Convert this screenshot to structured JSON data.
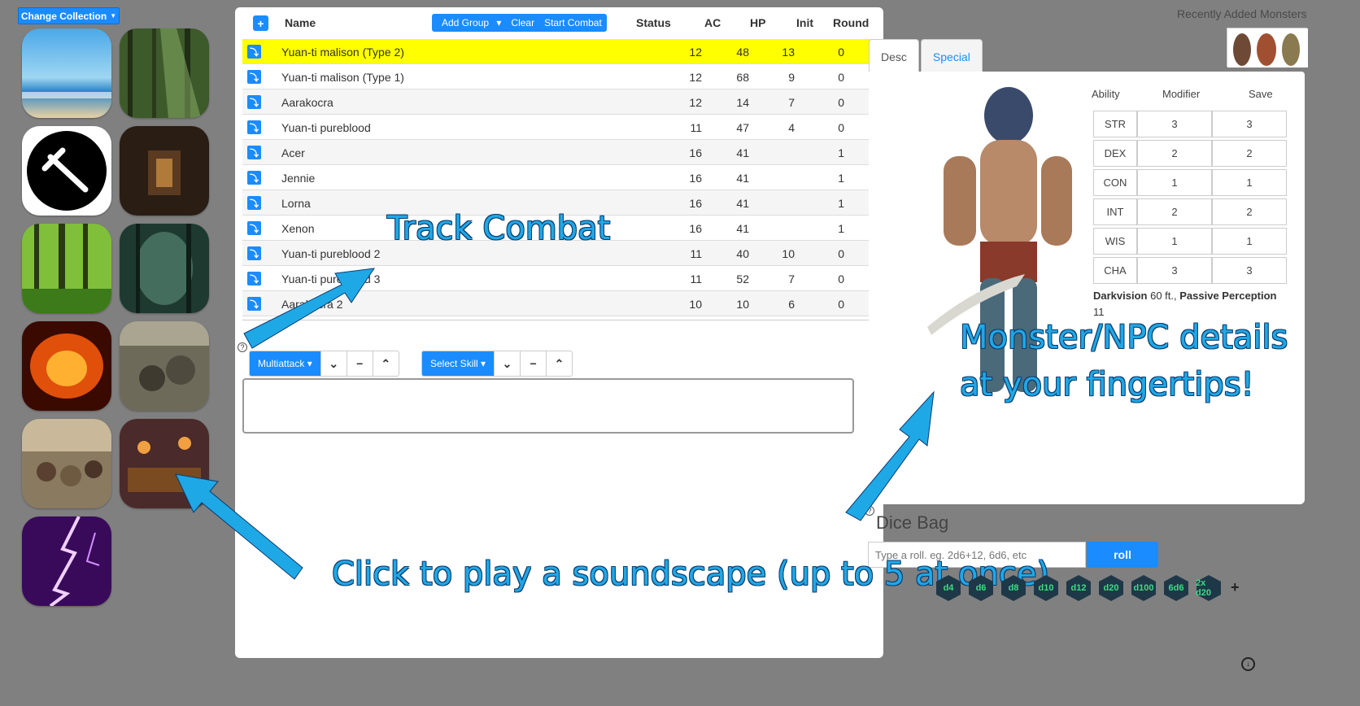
{
  "sidebar": {
    "change_collection_label": "Change Collection",
    "soundscapes": [
      {
        "name": "beach"
      },
      {
        "name": "forest-sunlight"
      },
      {
        "name": "combat-sword"
      },
      {
        "name": "dungeon-corridor"
      },
      {
        "name": "green-forest"
      },
      {
        "name": "dark-forest"
      },
      {
        "name": "fire"
      },
      {
        "name": "battle"
      },
      {
        "name": "market"
      },
      {
        "name": "tavern"
      },
      {
        "name": "lightning-storm"
      }
    ]
  },
  "combat": {
    "columns": {
      "name": "Name",
      "status": "Status",
      "ac": "AC",
      "hp": "HP",
      "init": "Init",
      "round": "Round"
    },
    "add_icon": "+",
    "buttons": {
      "add_group": "Add Group",
      "clear": "Clear",
      "start_combat": "Start Combat"
    },
    "rows": [
      {
        "name": "Yuan-ti malison (Type 2)",
        "ac": "12",
        "hp": "48",
        "init": "13",
        "round": "0",
        "active": true
      },
      {
        "name": "Yuan-ti malison (Type 1)",
        "ac": "12",
        "hp": "68",
        "init": "9",
        "round": "0"
      },
      {
        "name": "Aarakocra",
        "ac": "12",
        "hp": "14",
        "init": "7",
        "round": "0"
      },
      {
        "name": "Yuan-ti pureblood",
        "ac": "11",
        "hp": "47",
        "init": "4",
        "round": "0"
      },
      {
        "name": "Acer",
        "ac": "16",
        "hp": "41",
        "init": "",
        "round": "1"
      },
      {
        "name": "Jennie",
        "ac": "16",
        "hp": "41",
        "init": "",
        "round": "1"
      },
      {
        "name": "Lorna",
        "ac": "16",
        "hp": "41",
        "init": "",
        "round": "1"
      },
      {
        "name": "Xenon",
        "ac": "16",
        "hp": "41",
        "init": "",
        "round": "1"
      },
      {
        "name": "Yuan-ti pureblood 2",
        "ac": "11",
        "hp": "40",
        "init": "10",
        "round": "0"
      },
      {
        "name": "Yuan-ti pureblood 3",
        "ac": "11",
        "hp": "52",
        "init": "7",
        "round": "0"
      },
      {
        "name": "Aarakocra 2",
        "ac": "10",
        "hp": "10",
        "init": "6",
        "round": "0"
      }
    ],
    "multiattack_label": "Multiattack",
    "select_skill_label": "Select Skill",
    "help_icon": "?"
  },
  "recent": {
    "title": "Recently Added Monsters"
  },
  "details": {
    "tabs": [
      "Desc",
      "Special"
    ],
    "ability_header": {
      "ability": "Ability",
      "modifier": "Modifier",
      "save": "Save"
    },
    "abilities": [
      {
        "k": "STR",
        "mod": "3",
        "save": "3"
      },
      {
        "k": "DEX",
        "mod": "2",
        "save": "2"
      },
      {
        "k": "CON",
        "mod": "1",
        "save": "1"
      },
      {
        "k": "INT",
        "mod": "2",
        "save": "2"
      },
      {
        "k": "WIS",
        "mod": "1",
        "save": "1"
      },
      {
        "k": "CHA",
        "mod": "3",
        "save": "3"
      }
    ],
    "senses": {
      "darkvision_label": "Darkvision",
      "darkvision_value": "60 ft.,",
      "passive_label": "Passive Perception",
      "passive_value": "11"
    }
  },
  "dice": {
    "title": "Dice Bag",
    "input_placeholder": "Type a roll. eg. 2d6+12, 6d6, etc",
    "roll_label": "roll",
    "dice": [
      "d4",
      "d6",
      "d8",
      "d10",
      "d12",
      "d20",
      "d100",
      "6d6",
      "2x d20"
    ],
    "plus": "+"
  },
  "annotations": {
    "track": "Track Combat",
    "monster_line1": "Monster/NPC details",
    "monster_line2": "at your fingertips!",
    "soundscape": "Click to play a soundscape (up to 5 at once)"
  },
  "colors": {
    "accent": "#1a8cff",
    "active_row": "#ffff00",
    "annotation": "#1fa8e6"
  }
}
